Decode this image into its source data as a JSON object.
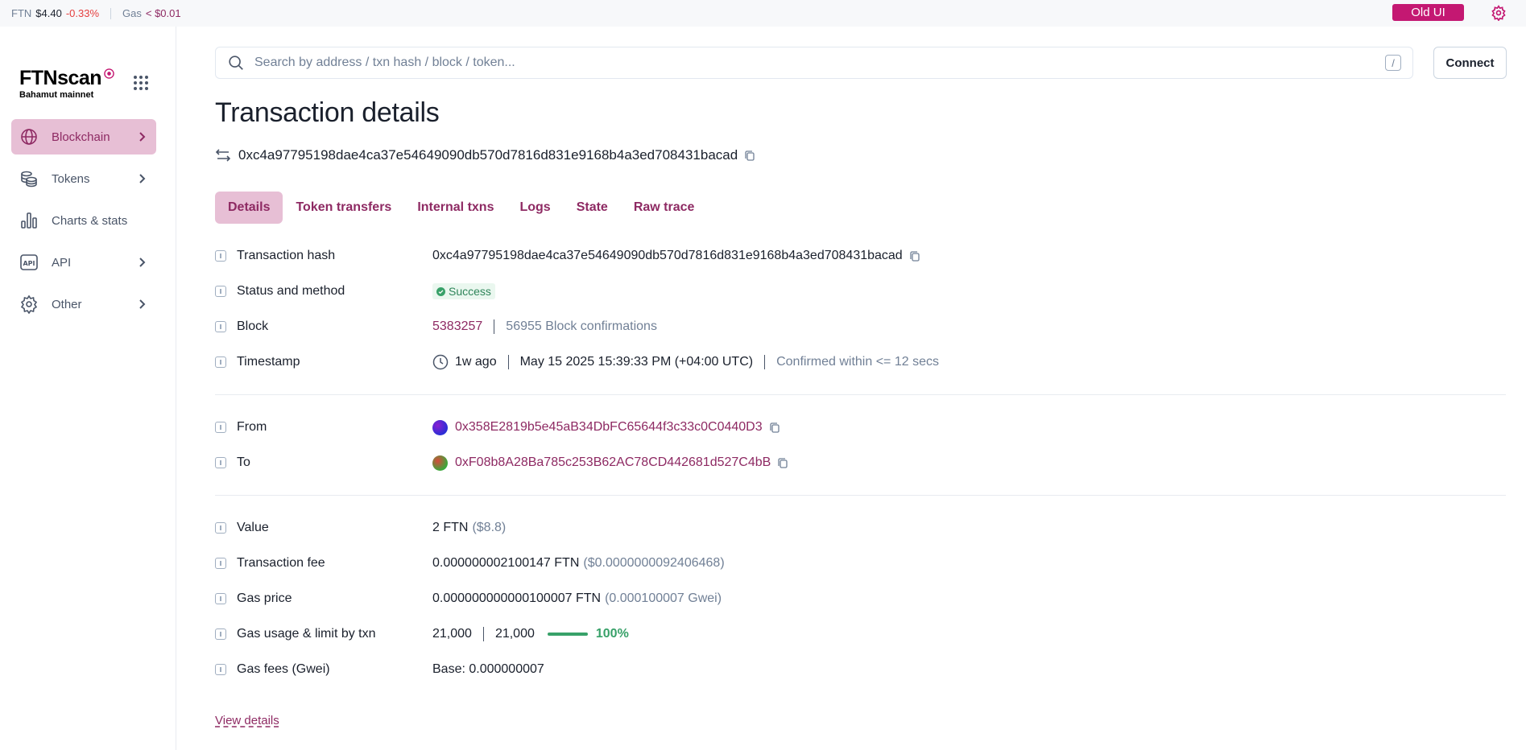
{
  "topbar": {
    "ftn_label": "FTN",
    "ftn_price": "$4.40",
    "ftn_change": "-0.33%",
    "gas_label": "Gas",
    "gas_value": "< $0.01",
    "old_ui_label": "Old UI"
  },
  "sidebar": {
    "logo_name": "FTNscan",
    "logo_sub": "Bahamut mainnet",
    "items": [
      {
        "label": "Blockchain",
        "icon": "globe-icon",
        "active": true,
        "has_chevron": true
      },
      {
        "label": "Tokens",
        "icon": "coins-icon",
        "active": false,
        "has_chevron": true
      },
      {
        "label": "Charts & stats",
        "icon": "chart-icon",
        "active": false,
        "has_chevron": false
      },
      {
        "label": "API",
        "icon": "api-icon",
        "active": false,
        "has_chevron": true
      },
      {
        "label": "Other",
        "icon": "gear-icon",
        "active": false,
        "has_chevron": true
      }
    ]
  },
  "search": {
    "placeholder": "Search by address / txn hash / block / token...",
    "shortcut": "/"
  },
  "connect_label": "Connect",
  "page_title": "Transaction details",
  "tx_hash": "0xc4a97795198dae4ca37e54649090db570d7816d831e9168b4a3ed708431bacad",
  "tabs": [
    {
      "label": "Details",
      "active": true
    },
    {
      "label": "Token transfers",
      "active": false
    },
    {
      "label": "Internal txns",
      "active": false
    },
    {
      "label": "Logs",
      "active": false
    },
    {
      "label": "State",
      "active": false
    },
    {
      "label": "Raw trace",
      "active": false
    }
  ],
  "details": {
    "hash_label": "Transaction hash",
    "hash_value": "0xc4a97795198dae4ca37e54649090db570d7816d831e9168b4a3ed708431bacad",
    "status_label": "Status and method",
    "status_value": "Success",
    "block_label": "Block",
    "block_number": "5383257",
    "block_confirmations": "56955 Block confirmations",
    "timestamp_label": "Timestamp",
    "timestamp_ago": "1w ago",
    "timestamp_date": "May 15 2025 15:39:33 PM (+04:00 UTC)",
    "timestamp_confirmed": "Confirmed within <= 12 secs",
    "from_label": "From",
    "from_address": "0x358E2819b5e45aB34DbFC65644f3c33c0C0440D3",
    "to_label": "To",
    "to_address": "0xF08b8A28Ba785c253B62AC78CD442681d527C4bB",
    "value_label": "Value",
    "value_amount": "2 FTN",
    "value_usd": "($8.8)",
    "fee_label": "Transaction fee",
    "fee_amount": "0.000000002100147 FTN",
    "fee_usd": "($0.0000000092406468)",
    "gasprice_label": "Gas price",
    "gasprice_amount": "0.000000000000100007 FTN",
    "gasprice_gwei": "(0.000100007 Gwei)",
    "gasusage_label": "Gas usage & limit by txn",
    "gas_used": "21,000",
    "gas_limit": "21,000",
    "gas_usage_pct": "100%",
    "gas_usage_fraction": 1.0,
    "gasfees_label": "Gas fees (Gwei)",
    "gasfees_base": "Base: 0.000000007"
  },
  "view_details_label": "View details",
  "colors": {
    "accent": "#8e2a63",
    "accent_bg": "#e7bfd5",
    "old_ui_bg": "#c41872",
    "success": "#38a169"
  }
}
